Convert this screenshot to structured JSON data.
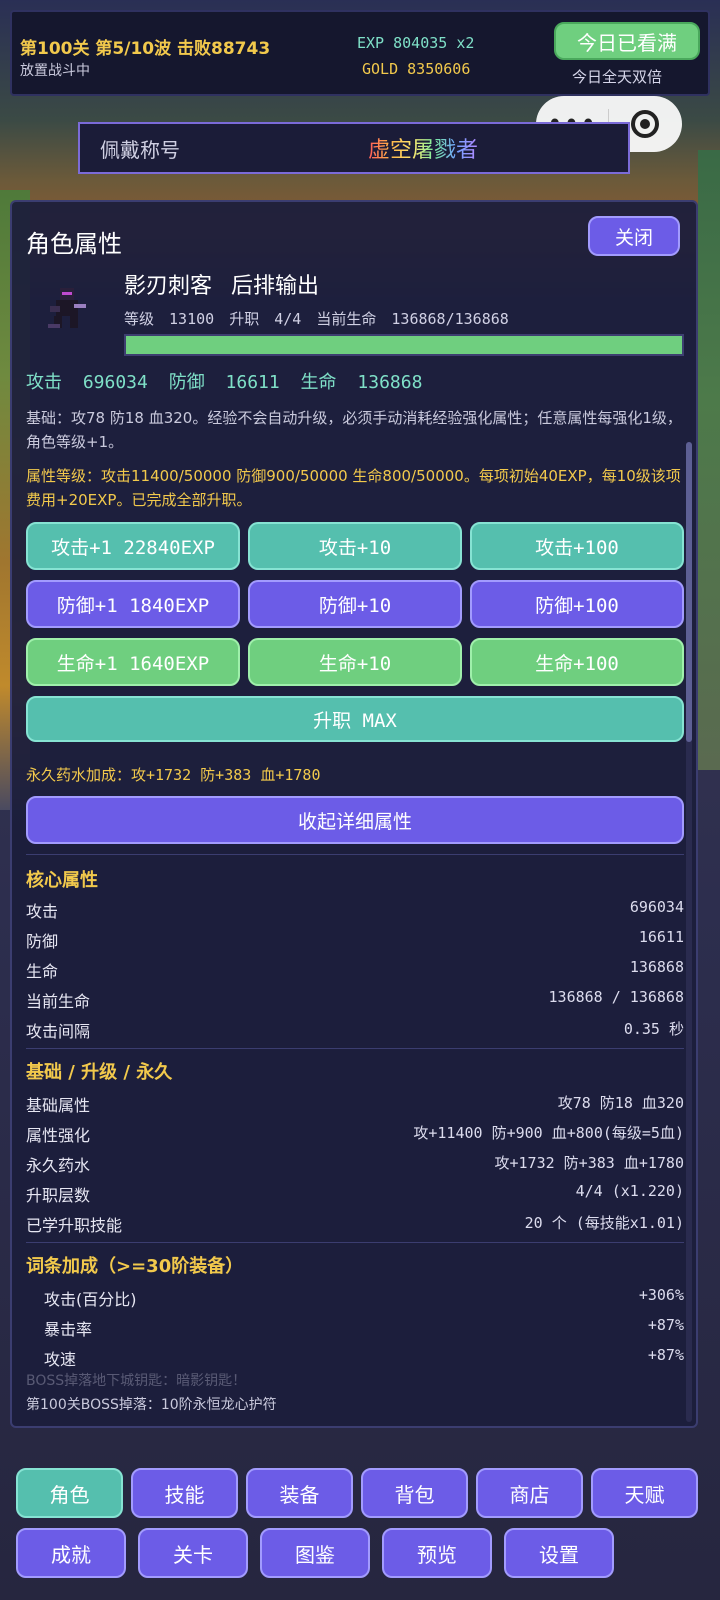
{
  "hud": {
    "stage_line": "第100关 第5/10波 击败88743",
    "status": "放置战斗中",
    "exp": "EXP 804035 x2",
    "gold": "GOLD 8350606",
    "watch_button": "今日已看满",
    "double_text": "今日全天双倍"
  },
  "title_badge": {
    "label": "佩戴称号",
    "name": "虚空屠戮者"
  },
  "panel": {
    "title": "角色属性",
    "close": "关闭",
    "role_name": "影刃刺客 后排输出",
    "role_stats": "等级 13100  升职 4/4  当前生命 136868/136868",
    "hp_fraction": 1.0,
    "stats_line": "攻击 696034 防御 16611 生命 136868",
    "desc1": "基础：攻78 防18 血320。经验不会自动升级，必须手动消耗经验强化属性；任意属性每强化1级，角色等级+1。",
    "desc2": "属性等级：攻击11400/50000 防御900/50000 生命800/50000。每项初始40EXP，每10级该项费用+20EXP。已完成全部升职。",
    "buttons": [
      [
        "攻击+1 22840EXP",
        "攻击+10",
        "攻击+100"
      ],
      [
        "防御+1 1840EXP",
        "防御+10",
        "防御+100"
      ],
      [
        "生命+1 1640EXP",
        "生命+10",
        "生命+100"
      ]
    ],
    "promote": "升职 MAX",
    "potion": "永久药水加成：攻+1732 防+383 血+1780",
    "collapse": "收起详细属性",
    "core": {
      "heading": "核心属性",
      "rows": [
        {
          "k": "攻击",
          "v": "696034"
        },
        {
          "k": "防御",
          "v": "16611"
        },
        {
          "k": "生命",
          "v": "136868"
        },
        {
          "k": "当前生命",
          "v": "136868 / 136868"
        },
        {
          "k": "攻击间隔",
          "v": "0.35 秒"
        }
      ]
    },
    "base": {
      "heading": "基础 / 升级 / 永久",
      "rows": [
        {
          "k": "基础属性",
          "v": "攻78 防18 血320"
        },
        {
          "k": "属性强化",
          "v": "攻+11400 防+900 血+800(每级=5血)"
        },
        {
          "k": "永久药水",
          "v": "攻+1732 防+383 血+1780"
        },
        {
          "k": "升职层数",
          "v": "4/4 (x1.220)"
        },
        {
          "k": "已学升职技能",
          "v": "20 个 (每技能x1.01)"
        }
      ]
    },
    "affix": {
      "heading": "词条加成（>=30阶装备）",
      "rows": [
        {
          "k": "攻击(百分比)",
          "v": "+306%"
        },
        {
          "k": "暴击率",
          "v": "+87%"
        },
        {
          "k": "攻速",
          "v": "+87%"
        }
      ]
    },
    "log": [
      "BOSS掉落地下城钥匙：暗影钥匙！",
      "第100关BOSS掉落：10阶永恒龙心护符"
    ]
  },
  "nav": {
    "row1": [
      "角色",
      "技能",
      "装备",
      "背包",
      "商店",
      "天赋"
    ],
    "row2": [
      "成就",
      "关卡",
      "图鉴",
      "预览",
      "设置"
    ]
  }
}
